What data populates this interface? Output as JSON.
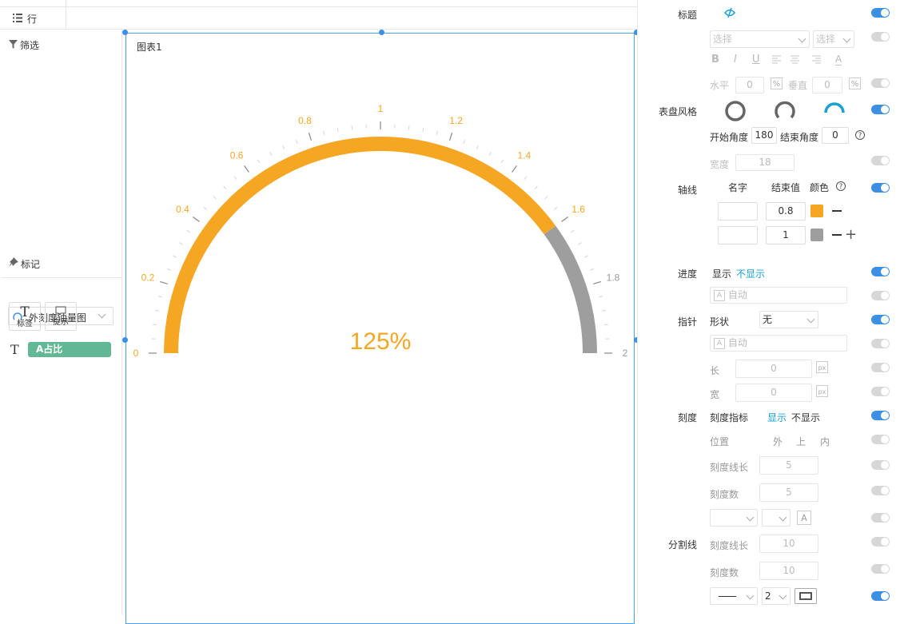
{
  "shelves": {
    "rows_label": "行"
  },
  "sidebar": {
    "filter_label": "筛选",
    "marks_label": "标记",
    "mark_type": "外刻度油量图",
    "label_button": "标签",
    "tooltip_button": "提示",
    "text_glyph": "T",
    "field_pill": "A占比"
  },
  "canvas": {
    "chart_label": "图表1",
    "value_text": "125%"
  },
  "chart_data": {
    "type": "gauge",
    "min": 0,
    "max": 2,
    "value": 1.25,
    "tick_labels": [
      "0",
      "0.2",
      "0.4",
      "0.6",
      "0.8",
      "1",
      "1.2",
      "1.4",
      "1.6",
      "1.8",
      "2"
    ],
    "axis_segments": [
      {
        "end": 0.8,
        "color": "#f5a623"
      },
      {
        "end": 1,
        "color": "#9e9e9e"
      }
    ],
    "start_angle": 180,
    "end_angle": 0,
    "center_label": "125%"
  },
  "panel": {
    "title_label": "标题",
    "select_placeholder": "选择",
    "select_placeholder2": "选择",
    "bold": "B",
    "italic": "I",
    "underline": "U",
    "font_color": "A",
    "horizontal_label": "水平",
    "horizontal_value": "0",
    "vertical_label": "垂直",
    "vertical_value": "0",
    "percent_icon": "%",
    "dial_style_label": "表盘风格",
    "start_angle_label": "开始角度",
    "start_angle_value": "180",
    "end_angle_label": "结束角度",
    "end_angle_value": "0",
    "help_icon": "?",
    "width_label": "宽度",
    "width_value": "18",
    "axis_label": "轴线",
    "axis_name_header": "名字",
    "axis_end_header": "结束值",
    "axis_color_header": "颜色",
    "axis_row1_end": "0.8",
    "axis_row2_end": "1",
    "axis_row1_color": "#f5a623",
    "axis_row2_color": "#9e9e9e",
    "plus": "+",
    "progress_label": "进度",
    "progress_show": "显示",
    "progress_hide": "不显示",
    "auto_text": "自动",
    "auto_text2": "自动",
    "auto_icon": "A",
    "pointer_label": "指针",
    "shape_label": "形状",
    "shape_value": "无",
    "length_label": "长",
    "length_value": "0",
    "pointer_width_label": "宽",
    "pointer_width_value": "0",
    "px_icon": "px",
    "scale_label": "刻度",
    "scale_indicator_label": "刻度指标",
    "scale_show": "显示",
    "scale_hide": "不显示",
    "position_label": "位置",
    "pos_out": "外",
    "pos_on": "上",
    "pos_in": "内",
    "tick_length_label": "刻度线长",
    "tick_length_value": "5",
    "tick_count_label": "刻度数",
    "tick_count_value": "5",
    "divider_label": "分割线",
    "div_tick_length_label": "刻度线长",
    "div_tick_length_value": "10",
    "div_tick_count_label": "刻度数",
    "div_tick_count_value": "10",
    "line_width_value": "2",
    "accent_color": "#3c8fe3"
  }
}
